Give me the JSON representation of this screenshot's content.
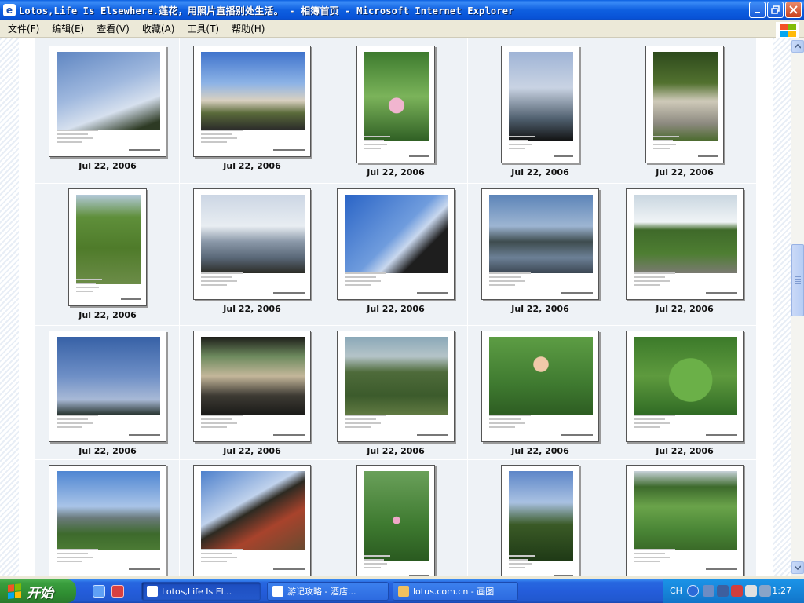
{
  "window": {
    "title": "Lotos,Life Is Elsewhere.莲花，用照片直播别处生活。 - 相簿首页 - Microsoft Internet Explorer",
    "minimize_icon": "minimize-icon",
    "maximize_icon": "restore-icon",
    "close_icon": "close-icon"
  },
  "menu": [
    "文件(F)",
    "编辑(E)",
    "查看(V)",
    "收藏(A)",
    "工具(T)",
    "帮助(H)"
  ],
  "gallery": {
    "rows": [
      [
        {
          "caption": "Jul 22, 2006",
          "scene": "crane-sky",
          "orientation": "landscape"
        },
        {
          "caption": "Jul 22, 2006",
          "scene": "gate-crowd",
          "orientation": "landscape"
        },
        {
          "caption": "Jul 22, 2006",
          "scene": "lotus-bud",
          "orientation": "portrait"
        },
        {
          "caption": "Jul 22, 2006",
          "scene": "clouds-trees",
          "orientation": "portrait"
        },
        {
          "caption": "Jul 22, 2006",
          "scene": "stone-ruins",
          "orientation": "portrait"
        }
      ],
      [
        {
          "caption": "Jul 22, 2006",
          "scene": "willow-path",
          "orientation": "portrait"
        },
        {
          "caption": "Jul 22, 2006",
          "scene": "lake-willows",
          "orientation": "landscape"
        },
        {
          "caption": "Jul 22, 2006",
          "scene": "pavilion-roof",
          "orientation": "landscape"
        },
        {
          "caption": "Jul 22, 2006",
          "scene": "lake-evening",
          "orientation": "landscape"
        },
        {
          "caption": "Jul 22, 2006",
          "scene": "marsh-stone",
          "orientation": "landscape"
        }
      ],
      [
        {
          "caption": "Jul 22, 2006",
          "scene": "blue-sky",
          "orientation": "landscape"
        },
        {
          "caption": "Jul 22, 2006",
          "scene": "restaurant",
          "orientation": "landscape"
        },
        {
          "caption": "Jul 22, 2006",
          "scene": "lotus-pond",
          "orientation": "landscape"
        },
        {
          "caption": "Jul 22, 2006",
          "scene": "girl-lotus",
          "orientation": "landscape"
        },
        {
          "caption": "Jul 22, 2006",
          "scene": "lotus-leaves",
          "orientation": "landscape"
        }
      ],
      [
        {
          "caption": "",
          "scene": "lake-pavilion",
          "orientation": "landscape"
        },
        {
          "caption": "",
          "scene": "red-corridor",
          "orientation": "landscape"
        },
        {
          "caption": "",
          "scene": "lotus-field",
          "orientation": "portrait"
        },
        {
          "caption": "",
          "scene": "willow-field",
          "orientation": "portrait"
        },
        {
          "caption": "",
          "scene": "lotus-wide",
          "orientation": "landscape"
        }
      ]
    ]
  },
  "taskbar": {
    "start_label": "开始",
    "tasks": [
      {
        "label": "Lotos,Life Is El...",
        "active": true
      },
      {
        "label": "游记攻略 - 酒店...",
        "active": false
      },
      {
        "label": "lotus.com.cn - 画图",
        "active": false
      }
    ],
    "lang": "CH",
    "clock": "1:27"
  },
  "scrollbar": {
    "up_icon": "scroll-up-icon",
    "down_icon": "scroll-down-icon"
  }
}
